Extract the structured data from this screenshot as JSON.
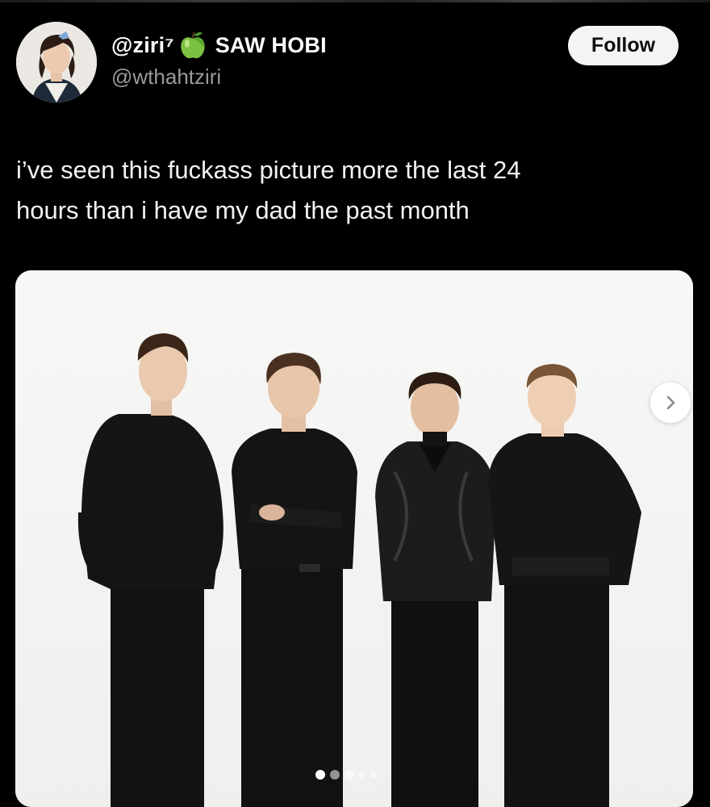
{
  "user": {
    "handle_display": "@ziri⁷",
    "display_name": "SAW HOBI",
    "username": "@wthahtziri",
    "emoji_icon": "green-apple-icon"
  },
  "follow_button": {
    "label": "Follow"
  },
  "tweet": {
    "line1": "i’ve seen this fuckass picture more the last 24",
    "line2": "hours than i have my dad the past month"
  },
  "media": {
    "description_icon": "photo",
    "carousel": {
      "current": 1,
      "total": 5
    }
  },
  "colors": {
    "background": "#000000",
    "text": "#ffffff",
    "secondary_text": "#9a9a9a",
    "follow_bg": "#f4f4f4",
    "photo_bg": "#f6f6f4"
  }
}
